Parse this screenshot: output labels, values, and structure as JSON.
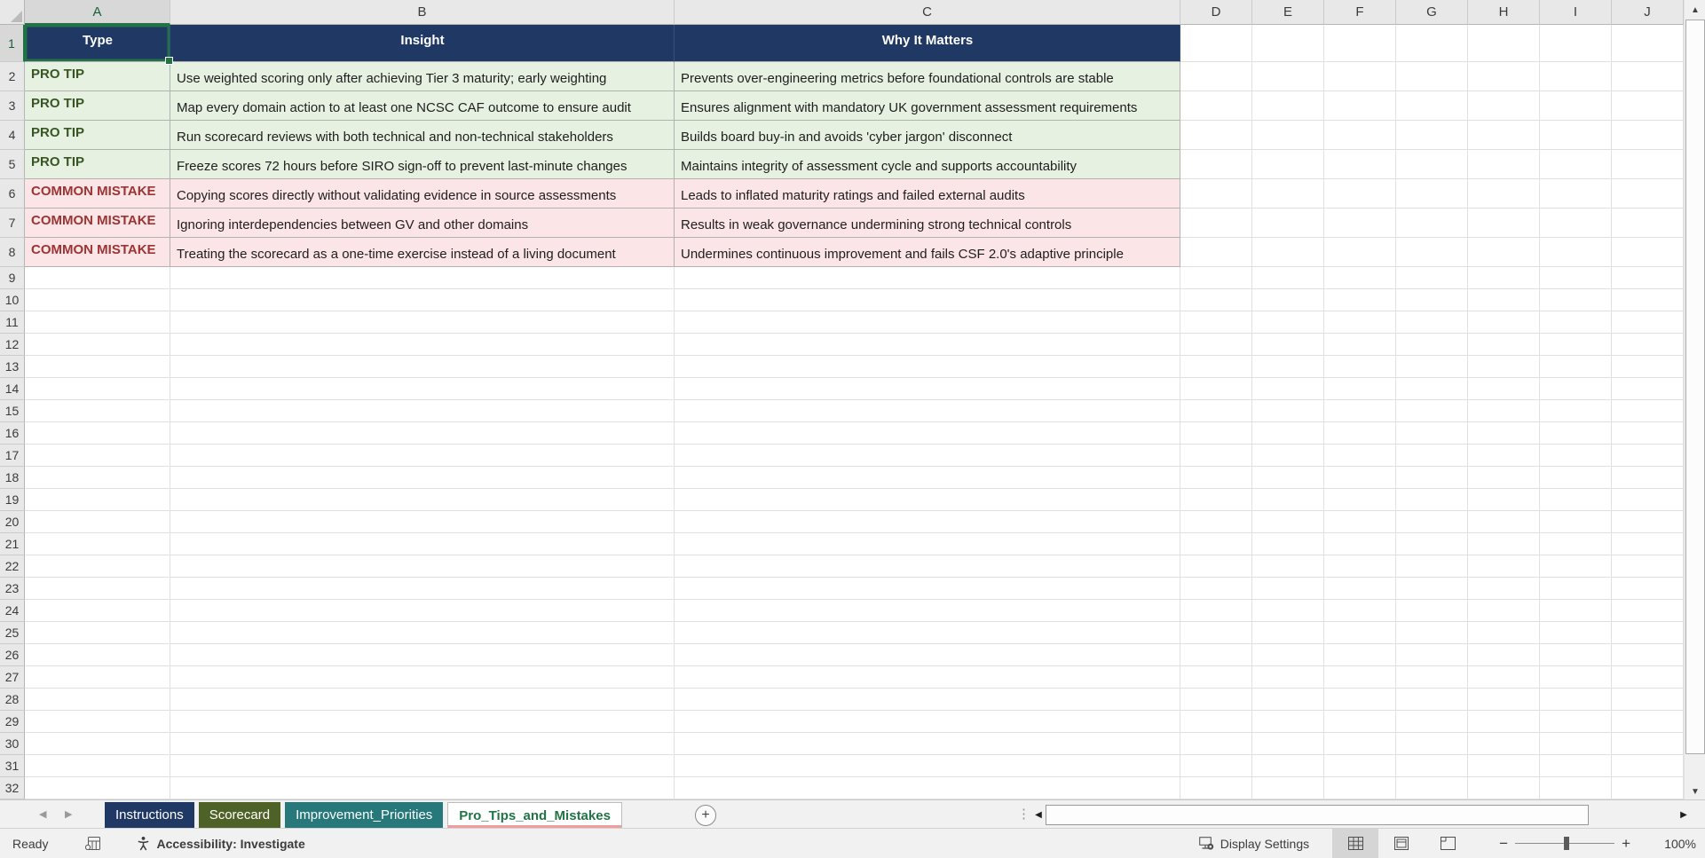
{
  "grid": {
    "column_letters": [
      "A",
      "B",
      "C",
      "D",
      "E",
      "F",
      "G",
      "H",
      "I",
      "J"
    ],
    "row_numbers": [
      1,
      2,
      3,
      4,
      5,
      6,
      7,
      8,
      9,
      10,
      11,
      12,
      13,
      14,
      15,
      16,
      17,
      18,
      19,
      20,
      21,
      22,
      23,
      24,
      25,
      26,
      27,
      28,
      29,
      30,
      31,
      32
    ],
    "selected_cell": "A1"
  },
  "table": {
    "headers": [
      "Type",
      "Insight",
      "Why It Matters"
    ],
    "rows": [
      {
        "type": "PRO TIP",
        "insight": "Use weighted scoring only after achieving Tier 3 maturity; early weighting",
        "why": "Prevents over-engineering metrics before foundational controls are stable"
      },
      {
        "type": "PRO TIP",
        "insight": "Map every domain action to at least one NCSC CAF outcome to ensure audit",
        "why": "Ensures alignment with mandatory UK government assessment requirements"
      },
      {
        "type": "PRO TIP",
        "insight": "Run scorecard reviews with both technical and non-technical stakeholders",
        "why": "Builds board buy-in and avoids 'cyber jargon' disconnect"
      },
      {
        "type": "PRO TIP",
        "insight": "Freeze scores 72 hours before SIRO sign-off to prevent last-minute changes",
        "why": "Maintains integrity of assessment cycle and supports accountability"
      },
      {
        "type": "COMMON MISTAKE",
        "insight": "Copying scores directly without validating evidence in source assessments",
        "why": "Leads to inflated maturity ratings and failed external audits"
      },
      {
        "type": "COMMON MISTAKE",
        "insight": "Ignoring interdependencies between GV and other domains",
        "why": "Results in weak governance undermining strong technical controls"
      },
      {
        "type": "COMMON MISTAKE",
        "insight": "Treating the scorecard as a one-time exercise instead of a living document",
        "why": "Undermines continuous improvement and fails CSF 2.0's adaptive principle"
      }
    ]
  },
  "sheet_tabs": {
    "tabs": [
      {
        "label": "Instructions",
        "active": false
      },
      {
        "label": "Scorecard",
        "active": false
      },
      {
        "label": "Improvement_Priorities",
        "active": false
      },
      {
        "label": "Pro_Tips_and_Mistakes",
        "active": true
      }
    ],
    "add_sheet_label": "+"
  },
  "status_bar": {
    "ready": "Ready",
    "accessibility": "Accessibility: Investigate",
    "display_settings": "Display Settings",
    "zoom_level": "100%"
  },
  "colors": {
    "header_bg": "#1F3864",
    "header_text": "#FFFFFF",
    "tip_bg": "#E7F1E2",
    "tip_text": "#375623",
    "mistake_bg": "#FBE5E6",
    "mistake_text": "#9C3434",
    "selection_green": "#217346",
    "tab_instructions": "#1F3864",
    "tab_scorecard": "#4E6227",
    "tab_improvement": "#26787B",
    "active_tab_text": "#217346",
    "active_tab_underline": "#EE9F9D"
  }
}
